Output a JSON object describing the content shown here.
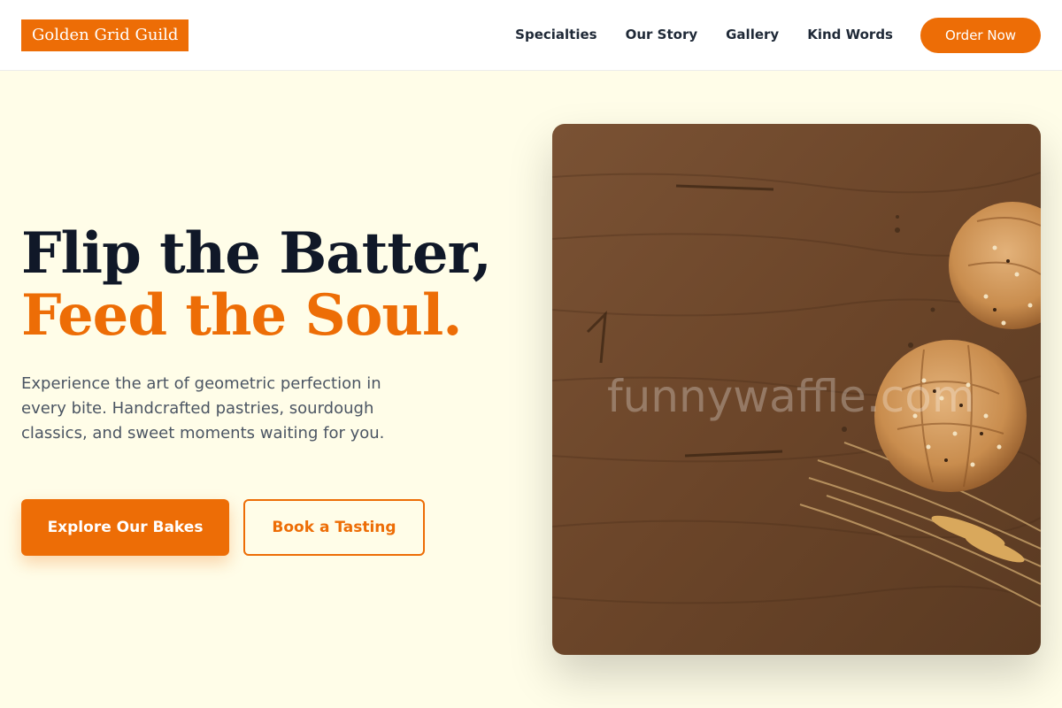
{
  "brand": {
    "name": "Golden Grid Guild",
    "accent_color": "#ed6d06"
  },
  "nav": {
    "links": [
      "Specialties",
      "Our Story",
      "Gallery",
      "Kind Words"
    ],
    "cta": "Order Now"
  },
  "hero": {
    "title_line1": "Flip the Batter,",
    "title_line2": "Feed the Soul.",
    "description": "Experience the art of geometric perfection in every bite. Handcrafted pastries, sourdough classics, and sweet moments waiting for you.",
    "primary_button": "Explore Our Bakes",
    "secondary_button": "Book a Tasting",
    "image": {
      "subject": "bread-rolls-and-wheat-on-wooden-table",
      "watermark": "funnywaffle.com"
    }
  }
}
